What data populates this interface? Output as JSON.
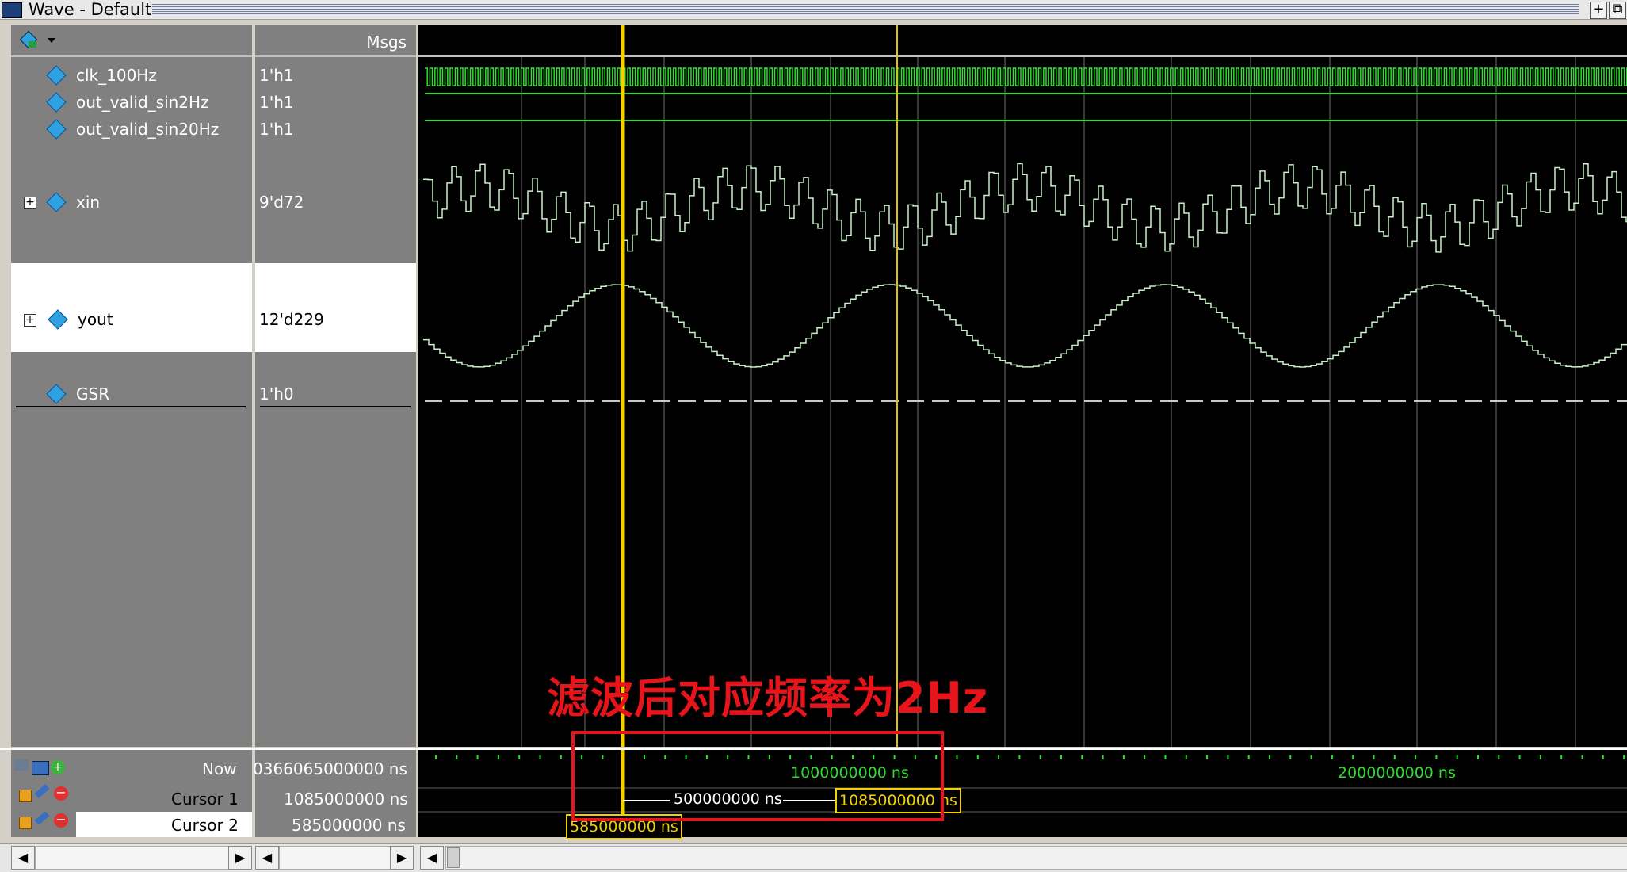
{
  "window": {
    "title": "Wave - Default",
    "buttons": {
      "dock": "+",
      "undock": "⧉"
    }
  },
  "header": {
    "msgs_label": "Msgs"
  },
  "signals": [
    {
      "name": "clk_100Hz",
      "value": "1'h1"
    },
    {
      "name": "out_valid_sin2Hz",
      "value": "1'h1"
    },
    {
      "name": "out_valid_sin20Hz",
      "value": "1'h1"
    },
    {
      "name": "xin",
      "value": "9'd72"
    },
    {
      "name": "yout",
      "value": "12'd229"
    },
    {
      "name": "GSR",
      "value": "1'h0"
    }
  ],
  "footer": {
    "now_label": "Now",
    "now_value": "0366065000000 ns",
    "cursor1_label": "Cursor 1",
    "cursor1_value": "1085000000 ns",
    "cursor2_label": "Cursor 2",
    "cursor2_value": "585000000 ns"
  },
  "timeline": {
    "tick_label_1": "1000000000 ns",
    "tick_label_2": "2000000000 ns",
    "delta_label": "500000000 ns",
    "cursor1_tag": "1085000000 ns",
    "cursor2_tag": "585000000 ns"
  },
  "annotation": {
    "text": "滤波后对应频率为2Hz"
  },
  "colors": {
    "wave_green": "#2dde2d",
    "analog": "#c8f0c8",
    "cursor_yellow": "#f3d200",
    "annotation_red": "#e8141c"
  }
}
